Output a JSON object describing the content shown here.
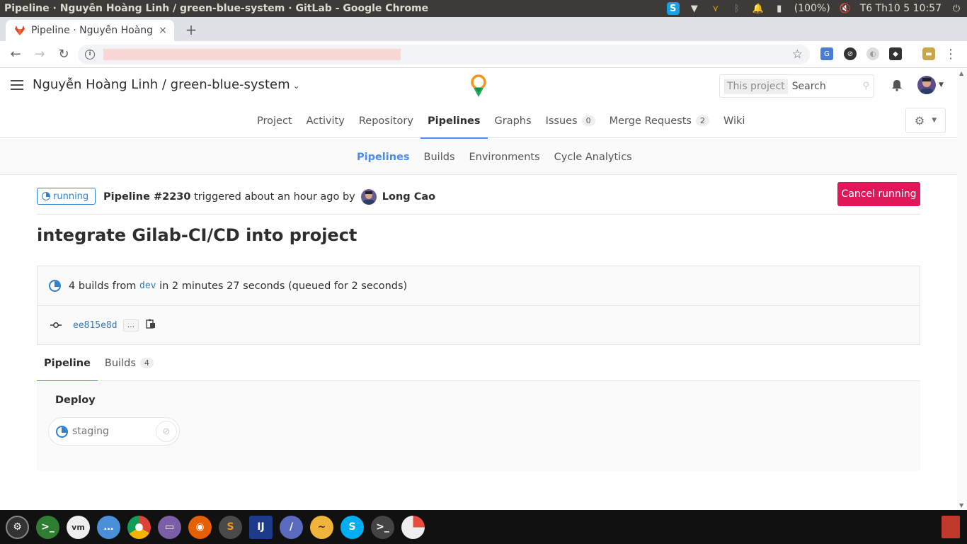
{
  "os": {
    "window_title": "Pipeline · Nguyễn Hoàng Linh / green-blue-system · GitLab - Google Chrome",
    "battery": "(100%)",
    "clock": "T6 Th10  5 10:57"
  },
  "browser": {
    "tab_title": "Pipeline · Nguyễn Hoàng",
    "tab_close": "×",
    "new_tab": "+"
  },
  "gitlab": {
    "project_title": "Nguyễn Hoàng Linh / green-blue-system",
    "search_scope": "This project",
    "search_placeholder": "Search",
    "main_nav": [
      {
        "label": "Project"
      },
      {
        "label": "Activity"
      },
      {
        "label": "Repository"
      },
      {
        "label": "Pipelines"
      },
      {
        "label": "Graphs"
      },
      {
        "label": "Issues",
        "count": "0"
      },
      {
        "label": "Merge Requests",
        "count": "2"
      },
      {
        "label": "Wiki"
      }
    ],
    "sub_nav": [
      {
        "label": "Pipelines"
      },
      {
        "label": "Builds"
      },
      {
        "label": "Environments"
      },
      {
        "label": "Cycle Analytics"
      }
    ]
  },
  "pipeline": {
    "status": "running",
    "id_label": "Pipeline #2230",
    "triggered_text": "triggered about an hour ago by",
    "author": "Long Cao",
    "cancel_label": "Cancel running",
    "commit_title": "integrate Gilab-CI/CD into project",
    "builds_prefix": "4 builds from",
    "branch": "dev",
    "builds_suffix": "in 2 minutes 27 seconds (queued for 2 seconds)",
    "commit_sha": "ee815e8d",
    "ellipsis": "...",
    "tabs": [
      {
        "label": "Pipeline"
      },
      {
        "label": "Builds",
        "count": "4"
      }
    ],
    "stage": "Deploy",
    "job": "staging"
  }
}
